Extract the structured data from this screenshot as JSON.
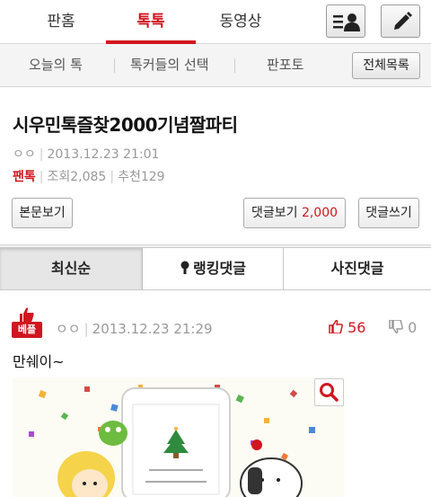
{
  "topnav": {
    "tabs": [
      "판홈",
      "톡톡",
      "동영상"
    ],
    "active_tab": "톡톡",
    "buttons": [
      {
        "name": "member-list-button",
        "icon": "user-list-icon"
      },
      {
        "name": "write-button",
        "icon": "pencil-icon"
      }
    ]
  },
  "subnav": {
    "items": [
      "오늘의 톡",
      "톡커들의 선택",
      "판포토"
    ],
    "all_list_button": "전체목록"
  },
  "post": {
    "title": "시우민톡즐찾2000기념짤파티",
    "author": "ㅇㅇ",
    "datetime": "2013.12.23 21:01",
    "category": "팬톡",
    "views_label": "조회",
    "views": "2,085",
    "recommend_label": "추천",
    "recommend": "129",
    "view_body_button": "본문보기",
    "view_comments_label": "댓글보기",
    "comment_count": "2,000",
    "write_comment_button": "댓글쓰기"
  },
  "comment_tabs": {
    "items": [
      "최신순",
      "랭킹댓글",
      "사진댓글"
    ],
    "active": "최신순"
  },
  "comment": {
    "badge": "베플",
    "author": "ㅇㅇ",
    "datetime": "2013.12.23 21:29",
    "likes": "56",
    "dislikes": "0",
    "text": "만쉐이~"
  },
  "colors": {
    "accent": "#d0161f",
    "muted": "#999999"
  }
}
